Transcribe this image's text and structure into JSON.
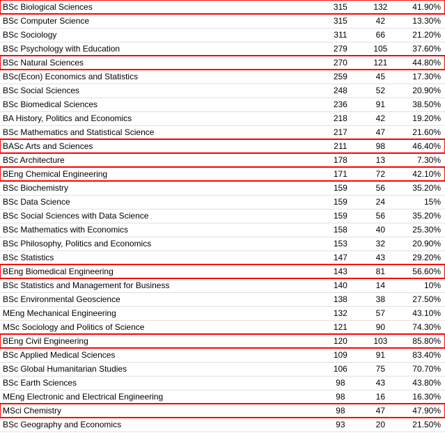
{
  "table": {
    "rows": [
      {
        "name": "BSc Biological Sciences",
        "col2": "315",
        "col3": "132",
        "col4": "41.90%",
        "highlight": true
      },
      {
        "name": "BSc Computer Science",
        "col2": "315",
        "col3": "42",
        "col4": "13.30%",
        "highlight": false
      },
      {
        "name": "BSc Sociology",
        "col2": "311",
        "col3": "66",
        "col4": "21.20%",
        "highlight": false
      },
      {
        "name": "BSc Psychology with Education",
        "col2": "279",
        "col3": "105",
        "col4": "37.60%",
        "highlight": false
      },
      {
        "name": "BSc Natural Sciences",
        "col2": "270",
        "col3": "121",
        "col4": "44.80%",
        "highlight": true
      },
      {
        "name": "BSc(Econ) Economics and Statistics",
        "col2": "259",
        "col3": "45",
        "col4": "17.30%",
        "highlight": false
      },
      {
        "name": "BSc Social Sciences",
        "col2": "248",
        "col3": "52",
        "col4": "20.90%",
        "highlight": false
      },
      {
        "name": "BSc Biomedical Sciences",
        "col2": "236",
        "col3": "91",
        "col4": "38.50%",
        "highlight": false
      },
      {
        "name": "BA History, Politics and Economics",
        "col2": "218",
        "col3": "42",
        "col4": "19.20%",
        "highlight": false
      },
      {
        "name": "BSc Mathematics and Statistical Science",
        "col2": "217",
        "col3": "47",
        "col4": "21.60%",
        "highlight": false
      },
      {
        "name": "BASc Arts and Sciences",
        "col2": "211",
        "col3": "98",
        "col4": "46.40%",
        "highlight": true
      },
      {
        "name": "BSc Architecture",
        "col2": "178",
        "col3": "13",
        "col4": "7.30%",
        "highlight": false
      },
      {
        "name": "BEng Chemical Engineering",
        "col2": "171",
        "col3": "72",
        "col4": "42.10%",
        "highlight": true
      },
      {
        "name": "BSc Biochemistry",
        "col2": "159",
        "col3": "56",
        "col4": "35.20%",
        "highlight": false
      },
      {
        "name": "BSc Data Science",
        "col2": "159",
        "col3": "24",
        "col4": "15%",
        "highlight": false
      },
      {
        "name": "BSc Social Sciences with Data Science",
        "col2": "159",
        "col3": "56",
        "col4": "35.20%",
        "highlight": false
      },
      {
        "name": "BSc Mathematics with Economics",
        "col2": "158",
        "col3": "40",
        "col4": "25.30%",
        "highlight": false
      },
      {
        "name": "BSc Philosophy, Politics and Economics",
        "col2": "153",
        "col3": "32",
        "col4": "20.90%",
        "highlight": false
      },
      {
        "name": "BSc Statistics",
        "col2": "147",
        "col3": "43",
        "col4": "29.20%",
        "highlight": false
      },
      {
        "name": "BEng Biomedical Engineering",
        "col2": "143",
        "col3": "81",
        "col4": "56.60%",
        "highlight": true
      },
      {
        "name": "BSc Statistics and Management for Business",
        "col2": "140",
        "col3": "14",
        "col4": "10%",
        "highlight": false
      },
      {
        "name": "BSc Environmental Geoscience",
        "col2": "138",
        "col3": "38",
        "col4": "27.50%",
        "highlight": false
      },
      {
        "name": "MEng Mechanical Engineering",
        "col2": "132",
        "col3": "57",
        "col4": "43.10%",
        "highlight": false
      },
      {
        "name": "MSc Sociology and Politics of Science",
        "col2": "121",
        "col3": "90",
        "col4": "74.30%",
        "highlight": false
      },
      {
        "name": "BEng Civil Engineering",
        "col2": "120",
        "col3": "103",
        "col4": "85.80%",
        "highlight": true
      },
      {
        "name": "BSc Applied Medical Sciences",
        "col2": "109",
        "col3": "91",
        "col4": "83.40%",
        "highlight": false
      },
      {
        "name": "BSc Global Humanitarian Studies",
        "col2": "106",
        "col3": "75",
        "col4": "70.70%",
        "highlight": false
      },
      {
        "name": "BSc Earth Sciences",
        "col2": "98",
        "col3": "43",
        "col4": "43.80%",
        "highlight": false
      },
      {
        "name": "MEng Electronic and Electrical Engineering",
        "col2": "98",
        "col3": "16",
        "col4": "16.30%",
        "highlight": false
      },
      {
        "name": "MSci Chemistry",
        "col2": "98",
        "col3": "47",
        "col4": "47.90%",
        "highlight": true
      },
      {
        "name": "BSc Geography and Economics",
        "col2": "93",
        "col3": "20",
        "col4": "21.50%",
        "highlight": false
      }
    ]
  }
}
